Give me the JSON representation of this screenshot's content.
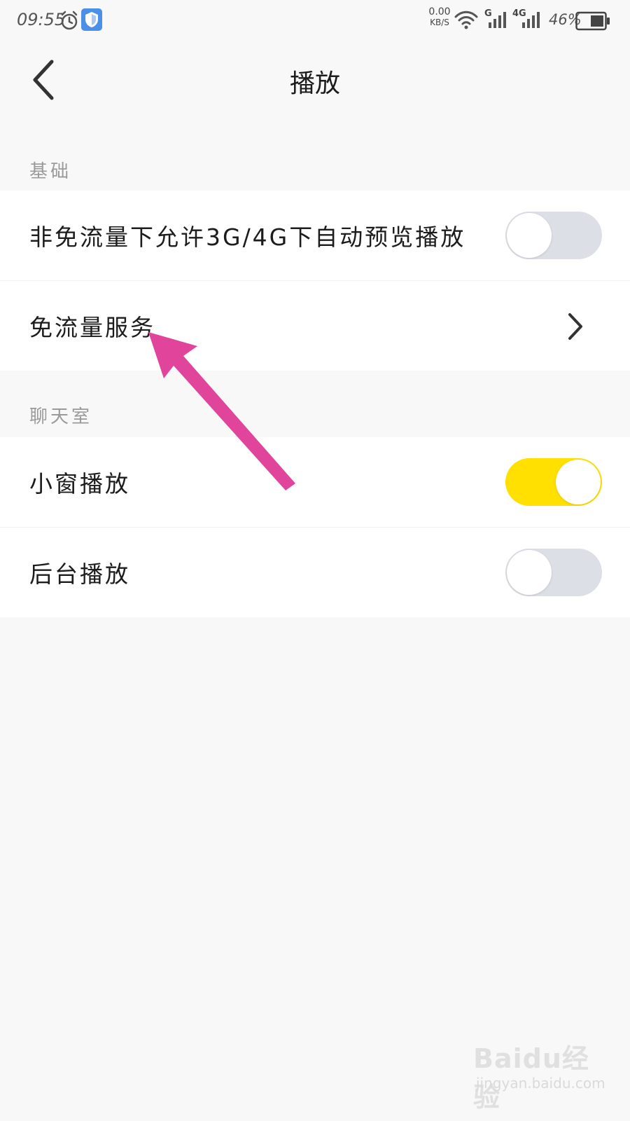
{
  "status_bar": {
    "time": "09:55",
    "net_speed_value": "0.00",
    "net_speed_unit": "KB/S",
    "signal_1_label": "G",
    "signal_2_label": "4G",
    "battery_percent": "46%",
    "icons": [
      "alarm-icon",
      "shield-icon",
      "wifi-icon",
      "signal-icon",
      "signal-icon",
      "battery-icon"
    ]
  },
  "header": {
    "title": "播放",
    "back_icon": "chevron-left-icon"
  },
  "sections": {
    "basic": {
      "header": "基础",
      "items": [
        {
          "label": "非免流量下允许3G/4G下自动预览播放",
          "type": "toggle",
          "on": false
        },
        {
          "label": "免流量服务",
          "type": "link",
          "icon": "chevron-right-icon"
        }
      ]
    },
    "chatroom": {
      "header": "聊天室",
      "items": [
        {
          "label": "小窗播放",
          "type": "toggle",
          "on": true
        },
        {
          "label": "后台播放",
          "type": "toggle",
          "on": false
        }
      ]
    }
  },
  "colors": {
    "accent_on": "#ffe000",
    "toggle_off": "#dcdfe6",
    "annotation_arrow": "#e0449b",
    "background": "#f8f8f8"
  },
  "watermark": {
    "logo": "Baidu经验",
    "site": "jingyan.baidu.com"
  }
}
